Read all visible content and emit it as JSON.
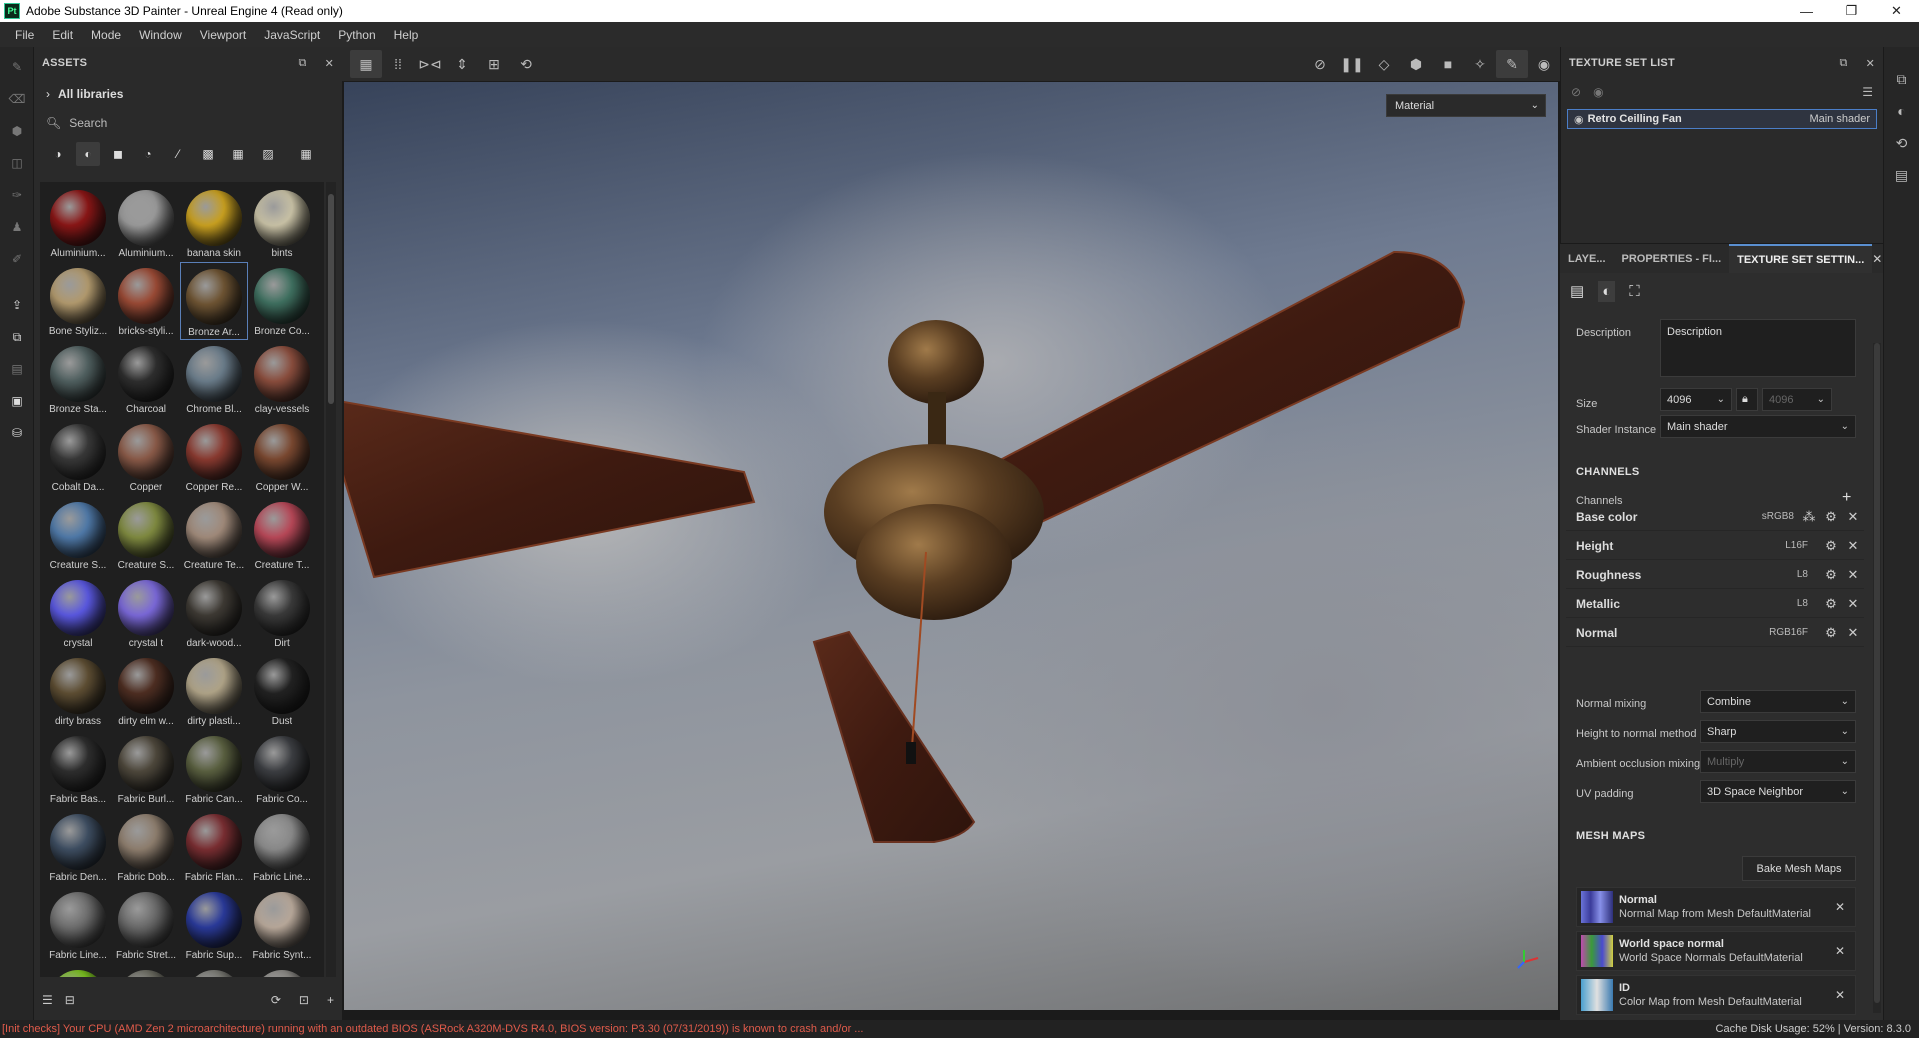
{
  "window": {
    "app_icon": "Pt",
    "title": "Adobe Substance 3D Painter - Unreal Engine 4 (Read only)",
    "minimize": "—",
    "maximize": "❐",
    "close": "✕"
  },
  "menu": [
    "File",
    "Edit",
    "Mode",
    "Window",
    "Viewport",
    "JavaScript",
    "Python",
    "Help"
  ],
  "assets": {
    "title": "ASSETS",
    "libraries": "All libraries",
    "search_placeholder": "Search",
    "materials": [
      {
        "label": "Aluminium...",
        "color": "#8a1616"
      },
      {
        "label": "Aluminium...",
        "color": "#9a9a9a"
      },
      {
        "label": "banana skin",
        "color": "#c9a020"
      },
      {
        "label": "bints",
        "color": "#c9c2a6"
      },
      {
        "label": "Bone Styliz...",
        "color": "#b29a6e"
      },
      {
        "label": "bricks-styli...",
        "color": "#9a4a35"
      },
      {
        "label": "Bronze Ar...",
        "color": "#6e5433"
      },
      {
        "label": "Bronze Co...",
        "color": "#3f7060"
      },
      {
        "label": "Bronze Sta...",
        "color": "#506060"
      },
      {
        "label": "Charcoal",
        "color": "#2e2e2e"
      },
      {
        "label": "Chrome Bl...",
        "color": "#6a7c8a"
      },
      {
        "label": "clay-vessels",
        "color": "#8a4d3d"
      },
      {
        "label": "Cobalt Da...",
        "color": "#383838"
      },
      {
        "label": "Copper",
        "color": "#8a5a48"
      },
      {
        "label": "Copper Re...",
        "color": "#8a3a30"
      },
      {
        "label": "Copper W...",
        "color": "#7a4830"
      },
      {
        "label": "Creature S...",
        "color": "#4f79a8"
      },
      {
        "label": "Creature S...",
        "color": "#7f8a40"
      },
      {
        "label": "Creature Te...",
        "color": "#a08a7a"
      },
      {
        "label": "Creature T...",
        "color": "#b84858"
      },
      {
        "label": "crystal",
        "color": "#5a58e0"
      },
      {
        "label": "crystal t",
        "color": "#7a68d8"
      },
      {
        "label": "dark-wood...",
        "color": "#3e3a34"
      },
      {
        "label": "Dirt",
        "color": "#3a3a3a"
      },
      {
        "label": "dirty brass",
        "color": "#5e4e33"
      },
      {
        "label": "dirty elm w...",
        "color": "#4e2e22"
      },
      {
        "label": "dirty plasti...",
        "color": "#b0a488"
      },
      {
        "label": "Dust",
        "color": "#222222"
      },
      {
        "label": "Fabric Bas...",
        "color": "#2e2e2e"
      },
      {
        "label": "Fabric Burl...",
        "color": "#4e483c"
      },
      {
        "label": "Fabric Can...",
        "color": "#5a6040"
      },
      {
        "label": "Fabric Co...",
        "color": "#3c3e42"
      },
      {
        "label": "Fabric Den...",
        "color": "#3e4e62"
      },
      {
        "label": "Fabric Dob...",
        "color": "#8e7e6e"
      },
      {
        "label": "Fabric Flan...",
        "color": "#7a2e32"
      },
      {
        "label": "Fabric Line...",
        "color": "#8a8a8a"
      },
      {
        "label": "Fabric Line...",
        "color": "#6e6e6e"
      },
      {
        "label": "Fabric Stret...",
        "color": "#6a6a6a"
      },
      {
        "label": "Fabric Sup...",
        "color": "#2a3a9a"
      },
      {
        "label": "Fabric Synt...",
        "color": "#b8a89a"
      },
      {
        "label": "",
        "color": "#7ac020"
      },
      {
        "label": "",
        "color": "#6a6a60"
      },
      {
        "label": "",
        "color": "#7a7a74"
      },
      {
        "label": "",
        "color": "#8a8884"
      }
    ],
    "selected_index": 6
  },
  "viewport": {
    "mode_dropdown": "Material"
  },
  "texture_set_list": {
    "title": "TEXTURE SET LIST",
    "item_name": "Retro Ceilling Fan",
    "item_shader": "Main shader"
  },
  "tabs": {
    "layers": "LAYE...",
    "properties": "PROPERTIES - FI...",
    "texture_set_settings": "TEXTURE SET SETTIN..."
  },
  "settings": {
    "description_label": "Description",
    "description_value": "Description",
    "size_label": "Size",
    "size_value": "4096",
    "size_linked": "4096",
    "shader_instance_label": "Shader Instance",
    "shader_instance_value": "Main shader",
    "channels_header": "CHANNELS",
    "channels_label": "Channels",
    "channels": [
      {
        "name": "Base color",
        "format": "sRGB8"
      },
      {
        "name": "Height",
        "format": "L16F"
      },
      {
        "name": "Roughness",
        "format": "L8"
      },
      {
        "name": "Metallic",
        "format": "L8"
      },
      {
        "name": "Normal",
        "format": "RGB16F"
      }
    ],
    "normal_mixing_label": "Normal mixing",
    "normal_mixing_value": "Combine",
    "height_to_normal_label": "Height to normal method",
    "height_to_normal_value": "Sharp",
    "ao_mixing_label": "Ambient occlusion mixing",
    "ao_mixing_value": "Multiply",
    "uv_padding_label": "UV padding",
    "uv_padding_value": "3D Space Neighbor",
    "mesh_maps_header": "MESH MAPS",
    "bake_button": "Bake Mesh Maps",
    "mesh_maps": [
      {
        "name": "Normal",
        "desc": "Normal Map from Mesh DefaultMaterial"
      },
      {
        "name": "World space normal",
        "desc": "World Space Normals DefaultMaterial"
      },
      {
        "name": "ID",
        "desc": "Color Map from Mesh DefaultMaterial"
      }
    ]
  },
  "status": {
    "warning": "[Init checks] Your CPU (AMD Zen 2 microarchitecture) running with an outdated BIOS (ASRock A320M-DVS R4.0, BIOS version: P3.30 (07/31/2019)) is known to crash and/or ...",
    "cache": "Cache Disk Usage:    52% | Version: 8.3.0"
  }
}
